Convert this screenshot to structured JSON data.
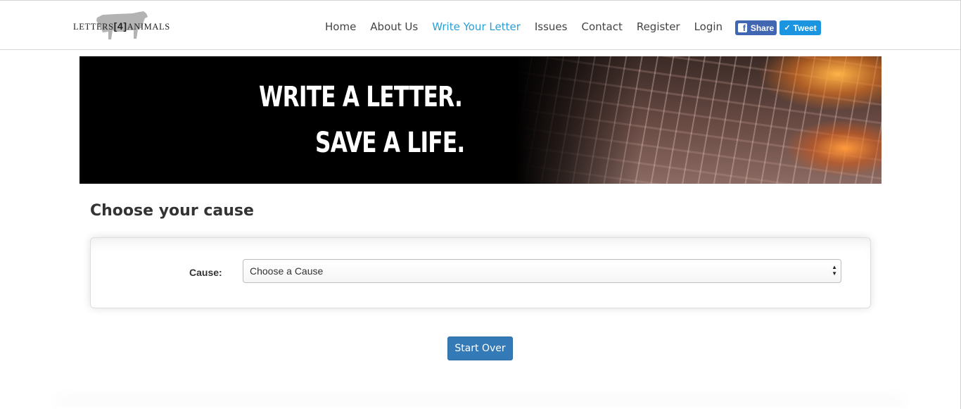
{
  "header": {
    "logo": {
      "text_left": "LETTERS",
      "text_mid": "[4]",
      "text_right": "ANIMALS",
      "icon": "cow-silhouette-icon"
    },
    "nav": [
      {
        "label": "Home",
        "active": false
      },
      {
        "label": "About Us",
        "active": false
      },
      {
        "label": "Write Your Letter",
        "active": true
      },
      {
        "label": "Issues",
        "active": false
      },
      {
        "label": "Contact",
        "active": false
      },
      {
        "label": "Register",
        "active": false
      },
      {
        "label": "Login",
        "active": false
      }
    ],
    "social": {
      "share_label": "Share",
      "share_icon": "facebook-icon",
      "tweet_label": "Tweet",
      "tweet_icon": "twitter-bird-icon"
    }
  },
  "banner": {
    "line1": "WRITE A LETTER.",
    "line2": "SAVE A LIFE."
  },
  "main": {
    "title": "Choose your cause",
    "form": {
      "cause_label": "Cause:",
      "cause_select_value": "Choose a Cause"
    },
    "start_over_label": "Start Over"
  },
  "colors": {
    "accent_link": "#2a9fd6",
    "primary_button": "#337ab7",
    "facebook": "#4267b2",
    "twitter": "#1b95e0"
  }
}
